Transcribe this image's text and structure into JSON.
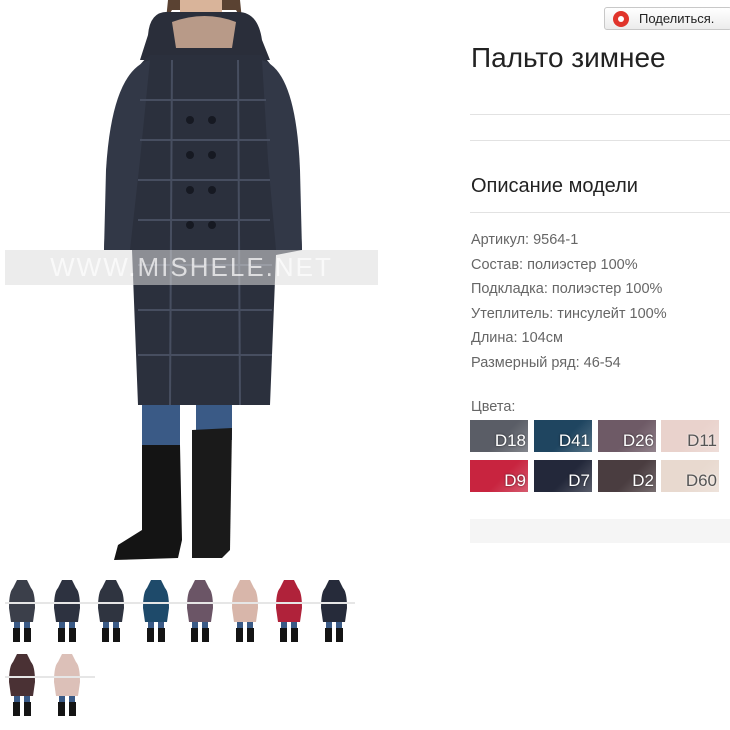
{
  "share": {
    "label": "Поделиться.",
    "icon": "share-sound-icon"
  },
  "product": {
    "title": "Пальто зимнее",
    "description_title": "Описание модели",
    "specs": [
      "Артикул: 9564-1",
      "Состав: полиэстер 100%",
      "Подкладка: полиэстер 100%",
      "Утеплитель: тинсулейт 100%",
      "Длина: 104см",
      "Размерный ряд: 46-54"
    ]
  },
  "watermark": {
    "text": "WWW.MISHELE.NET"
  },
  "colors": {
    "label": "Цвета:",
    "swatches": [
      {
        "code": "D18",
        "color": "#5a5d66"
      },
      {
        "code": "D41",
        "color": "#1f4560"
      },
      {
        "code": "D26",
        "color": "#6e5a66"
      },
      {
        "code": "D11",
        "color": "#e9d2cc"
      },
      {
        "code": "D9",
        "color": "#c8243f"
      },
      {
        "code": "D7",
        "color": "#23283a"
      },
      {
        "code": "D2",
        "color": "#4a3d40"
      },
      {
        "code": "D60",
        "color": "#e8d9cf"
      }
    ]
  },
  "thumbnails": {
    "colors": [
      "#3b3f4a",
      "#2d3240",
      "#2f3440",
      "#1e4a6a",
      "#6b5566",
      "#d8b6aa",
      "#b0223a",
      "#262b3a",
      "#4a3134",
      "#dcc0b8"
    ]
  }
}
